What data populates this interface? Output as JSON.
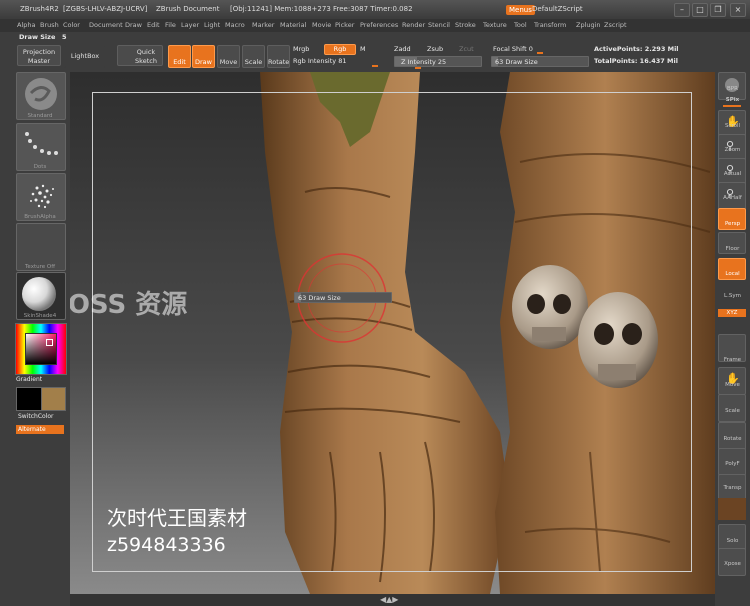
{
  "titlebar": {
    "app": "ZBrush4R2",
    "license": "[ZGBS-LHLV-ABZJ-UCRV]",
    "document": "ZBrush Document",
    "stats": "[Obj:11241] Mem:1088+273 Free:3087 Timer:0.082",
    "menus_label": "Menus",
    "script_label": "DefaultZScript"
  },
  "menus": [
    "Alpha",
    "Brush",
    "Color",
    "Document",
    "Draw",
    "Edit",
    "File",
    "Layer",
    "Light",
    "Macro",
    "Marker",
    "Material",
    "Movie",
    "Picker",
    "Preferences",
    "Render",
    "Stencil",
    "Stroke",
    "Texture",
    "Tool",
    "Transform",
    "Zplugin",
    "Zscript"
  ],
  "drawsize_row": {
    "label": "Draw Size",
    "value": "5"
  },
  "shelf": {
    "projection_master": "Projection Master",
    "lightbox": "LightBox",
    "quick_sketch": "Quick Sketch",
    "edit": "Edit",
    "draw": "Draw",
    "move": "Move",
    "scale": "Scale",
    "rotate": "Rotate",
    "mrgb": "Mrgb",
    "rgb": "Rgb",
    "m": "M",
    "rgb_intensity": "Rgb Intensity 81",
    "zadd": "Zadd",
    "zsub": "Zsub",
    "zcut": "Zcut",
    "z_intensity": "Z Intensity 25",
    "focal_shift": "Focal Shift 0",
    "draw_size_slider": "63 Draw Size",
    "active_points": "ActivePoints: 2.293 Mil",
    "total_points": "TotalPoints: 16.437 Mil"
  },
  "left": {
    "brush": "Standard",
    "stroke": "Dots",
    "alpha": "BrushAlpha",
    "texture": "Texture Off",
    "material": "SkinShade4",
    "gradient": "Gradient",
    "switchcolor": "SwitchColor",
    "alternate": "Alternate",
    "colors": {
      "main": "#000000",
      "secondary": "#a27f4a",
      "accent": "#e8731e"
    }
  },
  "right": [
    "BPR",
    "SPix",
    "Scroll",
    "Zoom",
    "Actual",
    "AAHalf",
    "Persp",
    "Floor",
    "Local",
    "L.Sym",
    "XYZ",
    "Frame",
    "Move",
    "Scale",
    "Rotate",
    "PolyF",
    "Transp",
    "Solo",
    "Xpose"
  ],
  "canvas": {
    "brush_cursor_label": "63 Draw Size",
    "watermark_logo": "BOSS 资源",
    "watermark_title": "次时代王国素材",
    "watermark_id": "z594843336"
  }
}
